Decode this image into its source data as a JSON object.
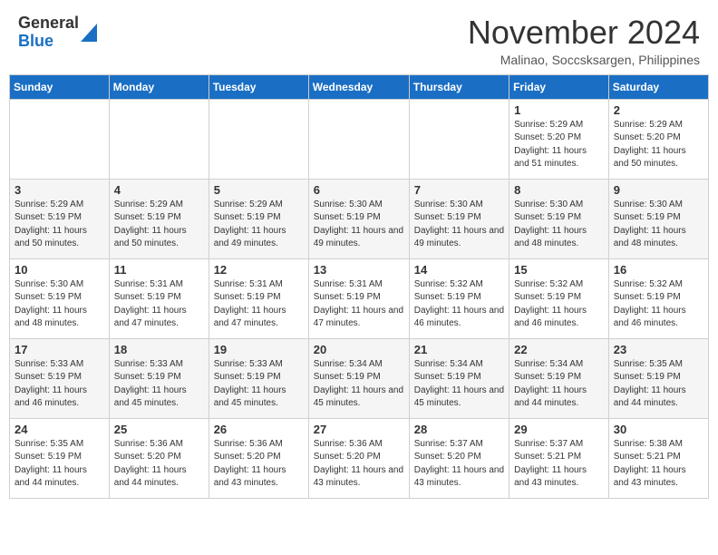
{
  "header": {
    "logo_general": "General",
    "logo_blue": "Blue",
    "month_title": "November 2024",
    "subtitle": "Malinao, Soccsksargen, Philippines"
  },
  "weekdays": [
    "Sunday",
    "Monday",
    "Tuesday",
    "Wednesday",
    "Thursday",
    "Friday",
    "Saturday"
  ],
  "weeks": [
    [
      {
        "day": "",
        "info": ""
      },
      {
        "day": "",
        "info": ""
      },
      {
        "day": "",
        "info": ""
      },
      {
        "day": "",
        "info": ""
      },
      {
        "day": "",
        "info": ""
      },
      {
        "day": "1",
        "info": "Sunrise: 5:29 AM\nSunset: 5:20 PM\nDaylight: 11 hours and 51 minutes."
      },
      {
        "day": "2",
        "info": "Sunrise: 5:29 AM\nSunset: 5:20 PM\nDaylight: 11 hours and 50 minutes."
      }
    ],
    [
      {
        "day": "3",
        "info": "Sunrise: 5:29 AM\nSunset: 5:19 PM\nDaylight: 11 hours and 50 minutes."
      },
      {
        "day": "4",
        "info": "Sunrise: 5:29 AM\nSunset: 5:19 PM\nDaylight: 11 hours and 50 minutes."
      },
      {
        "day": "5",
        "info": "Sunrise: 5:29 AM\nSunset: 5:19 PM\nDaylight: 11 hours and 49 minutes."
      },
      {
        "day": "6",
        "info": "Sunrise: 5:30 AM\nSunset: 5:19 PM\nDaylight: 11 hours and 49 minutes."
      },
      {
        "day": "7",
        "info": "Sunrise: 5:30 AM\nSunset: 5:19 PM\nDaylight: 11 hours and 49 minutes."
      },
      {
        "day": "8",
        "info": "Sunrise: 5:30 AM\nSunset: 5:19 PM\nDaylight: 11 hours and 48 minutes."
      },
      {
        "day": "9",
        "info": "Sunrise: 5:30 AM\nSunset: 5:19 PM\nDaylight: 11 hours and 48 minutes."
      }
    ],
    [
      {
        "day": "10",
        "info": "Sunrise: 5:30 AM\nSunset: 5:19 PM\nDaylight: 11 hours and 48 minutes."
      },
      {
        "day": "11",
        "info": "Sunrise: 5:31 AM\nSunset: 5:19 PM\nDaylight: 11 hours and 47 minutes."
      },
      {
        "day": "12",
        "info": "Sunrise: 5:31 AM\nSunset: 5:19 PM\nDaylight: 11 hours and 47 minutes."
      },
      {
        "day": "13",
        "info": "Sunrise: 5:31 AM\nSunset: 5:19 PM\nDaylight: 11 hours and 47 minutes."
      },
      {
        "day": "14",
        "info": "Sunrise: 5:32 AM\nSunset: 5:19 PM\nDaylight: 11 hours and 46 minutes."
      },
      {
        "day": "15",
        "info": "Sunrise: 5:32 AM\nSunset: 5:19 PM\nDaylight: 11 hours and 46 minutes."
      },
      {
        "day": "16",
        "info": "Sunrise: 5:32 AM\nSunset: 5:19 PM\nDaylight: 11 hours and 46 minutes."
      }
    ],
    [
      {
        "day": "17",
        "info": "Sunrise: 5:33 AM\nSunset: 5:19 PM\nDaylight: 11 hours and 46 minutes."
      },
      {
        "day": "18",
        "info": "Sunrise: 5:33 AM\nSunset: 5:19 PM\nDaylight: 11 hours and 45 minutes."
      },
      {
        "day": "19",
        "info": "Sunrise: 5:33 AM\nSunset: 5:19 PM\nDaylight: 11 hours and 45 minutes."
      },
      {
        "day": "20",
        "info": "Sunrise: 5:34 AM\nSunset: 5:19 PM\nDaylight: 11 hours and 45 minutes."
      },
      {
        "day": "21",
        "info": "Sunrise: 5:34 AM\nSunset: 5:19 PM\nDaylight: 11 hours and 45 minutes."
      },
      {
        "day": "22",
        "info": "Sunrise: 5:34 AM\nSunset: 5:19 PM\nDaylight: 11 hours and 44 minutes."
      },
      {
        "day": "23",
        "info": "Sunrise: 5:35 AM\nSunset: 5:19 PM\nDaylight: 11 hours and 44 minutes."
      }
    ],
    [
      {
        "day": "24",
        "info": "Sunrise: 5:35 AM\nSunset: 5:19 PM\nDaylight: 11 hours and 44 minutes."
      },
      {
        "day": "25",
        "info": "Sunrise: 5:36 AM\nSunset: 5:20 PM\nDaylight: 11 hours and 44 minutes."
      },
      {
        "day": "26",
        "info": "Sunrise: 5:36 AM\nSunset: 5:20 PM\nDaylight: 11 hours and 43 minutes."
      },
      {
        "day": "27",
        "info": "Sunrise: 5:36 AM\nSunset: 5:20 PM\nDaylight: 11 hours and 43 minutes."
      },
      {
        "day": "28",
        "info": "Sunrise: 5:37 AM\nSunset: 5:20 PM\nDaylight: 11 hours and 43 minutes."
      },
      {
        "day": "29",
        "info": "Sunrise: 5:37 AM\nSunset: 5:21 PM\nDaylight: 11 hours and 43 minutes."
      },
      {
        "day": "30",
        "info": "Sunrise: 5:38 AM\nSunset: 5:21 PM\nDaylight: 11 hours and 43 minutes."
      }
    ]
  ]
}
